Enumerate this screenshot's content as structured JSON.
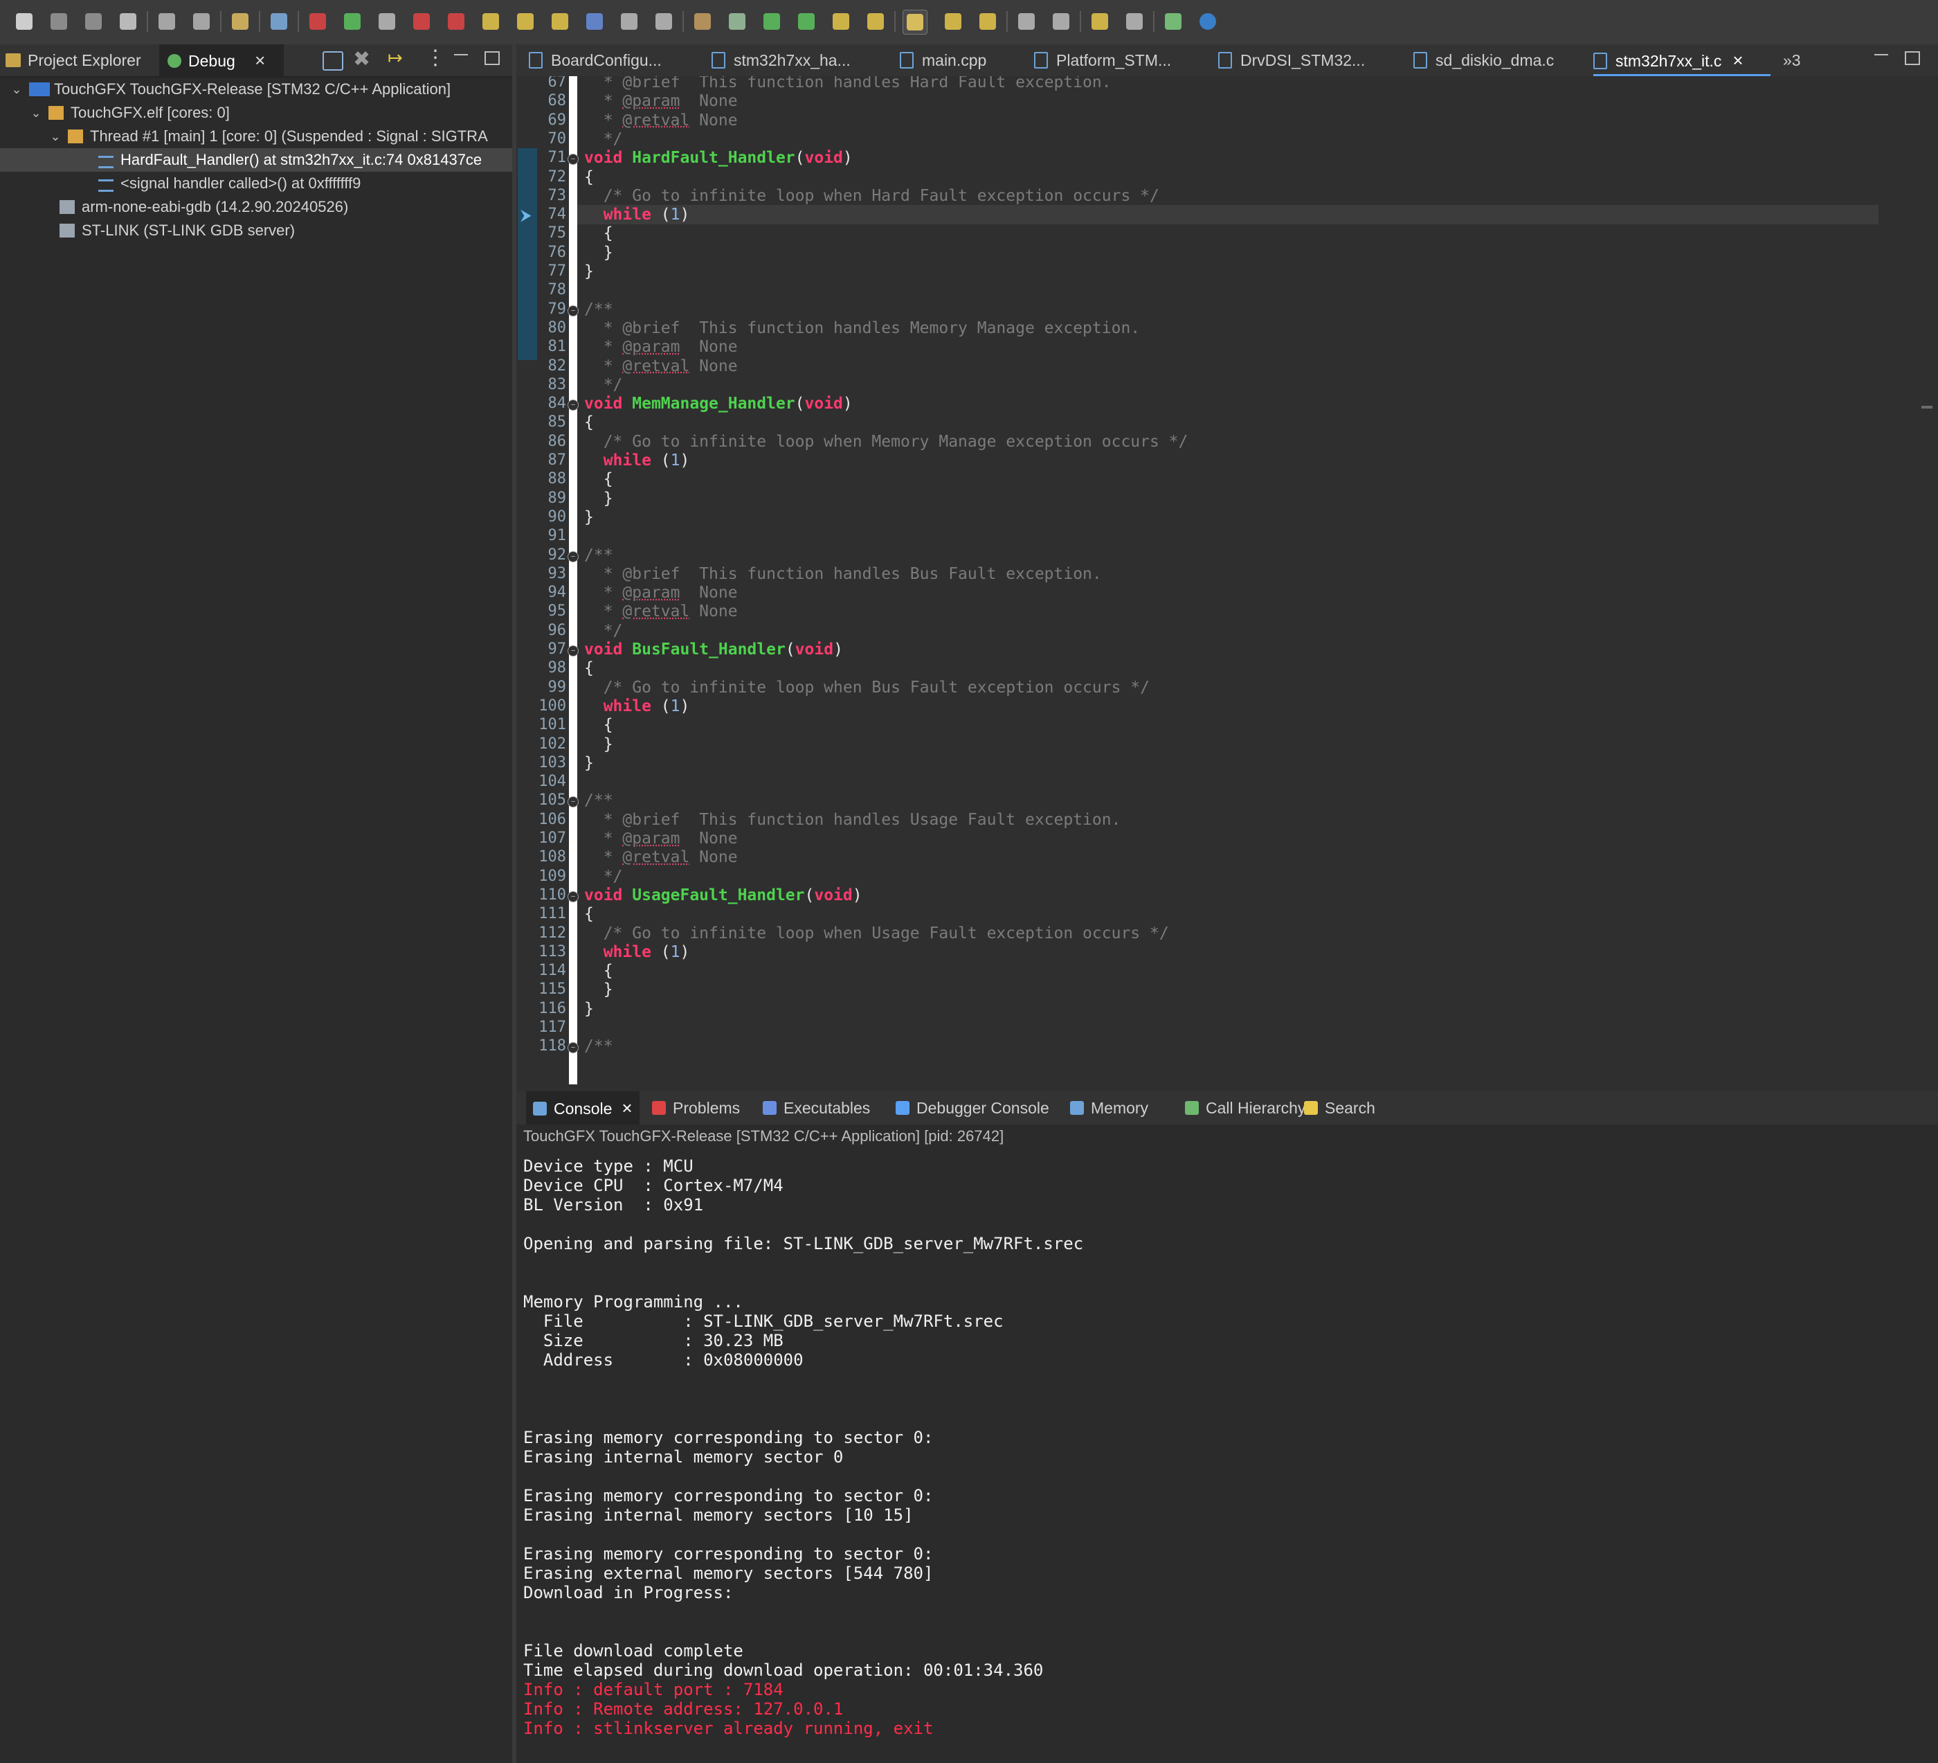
{
  "toolbar": {
    "buttons": [
      "new-icon",
      "save-icon",
      "save-all-icon",
      "build-icon",
      "undo-icon",
      "redo-icon",
      "refresh-icon",
      "search-icon",
      "debug-stop-icon",
      "resume-icon",
      "suspend-icon",
      "terminate-icon",
      "disconnect-icon",
      "step-into-icon",
      "step-over-icon",
      "step-return-icon",
      "instruction-step-icon",
      "drop-frame-icon",
      "use-step-filters-icon",
      "settings-icon",
      "target-icon",
      "run-icon",
      "debug-icon",
      "open-folder-icon",
      "pen-icon",
      "highlight-icon",
      "next-annotation-icon",
      "prev-annotation-icon",
      "back-icon",
      "forward-icon",
      "nav-back-icon",
      "nav-forward-icon",
      "open-perspective-icon",
      "info-icon"
    ]
  },
  "left_panel": {
    "tabs": [
      {
        "label": "Project Explorer",
        "active": false
      },
      {
        "label": "Debug",
        "active": true
      }
    ],
    "tree": [
      {
        "indent": 0,
        "twist": "v",
        "icon": "ide",
        "label": "TouchGFX TouchGFX-Release [STM32 C/C++ Application]"
      },
      {
        "indent": 1,
        "twist": "v",
        "icon": "elf",
        "label": "TouchGFX.elf [cores: 0]"
      },
      {
        "indent": 2,
        "twist": "v",
        "icon": "thread",
        "label": "Thread #1 [main] 1 [core: 0] (Suspended : Signal : SIGTRA"
      },
      {
        "indent": 3,
        "twist": "",
        "icon": "frame",
        "label": "HardFault_Handler() at stm32h7xx_it.c:74 0x81437ce",
        "selected": true
      },
      {
        "indent": 3,
        "twist": "",
        "icon": "frame",
        "label": "<signal handler called>() at 0xfffffff9"
      },
      {
        "indent": 1,
        "twist": "",
        "icon": "gdb",
        "label": "arm-none-eabi-gdb (14.2.90.20240526)"
      },
      {
        "indent": 1,
        "twist": "",
        "icon": "gdb",
        "label": "ST-LINK (ST-LINK GDB server)"
      }
    ]
  },
  "editor": {
    "tabs": [
      {
        "label": "BoardConfigu...",
        "active": false
      },
      {
        "label": "stm32h7xx_ha...",
        "active": false
      },
      {
        "label": "main.cpp",
        "active": false
      },
      {
        "label": "Platform_STM...",
        "active": false
      },
      {
        "label": "DrvDSI_STM32...",
        "active": false
      },
      {
        "label": "sd_diskio_dma.c",
        "active": false
      },
      {
        "label": "stm32h7xx_it.c",
        "active": true
      }
    ],
    "overflow_label": "»3",
    "lines": [
      {
        "n": "67",
        "t": "c",
        "text": "  * @brief  This function handles Hard Fault exception."
      },
      {
        "n": "68",
        "t": "p",
        "text": "  * @param  None"
      },
      {
        "n": "69",
        "t": "r",
        "text": "  * @retval None"
      },
      {
        "n": "70",
        "t": "c",
        "text": "  */"
      },
      {
        "n": "71",
        "t": "fn",
        "fold": true,
        "name": "HardFault_Handler"
      },
      {
        "n": "72",
        "t": "plain",
        "text": "{"
      },
      {
        "n": "73",
        "t": "c",
        "text": "  /* Go to infinite loop when Hard Fault exception occurs */"
      },
      {
        "n": "74",
        "t": "w",
        "current": true
      },
      {
        "n": "75",
        "t": "plain",
        "text": "  {"
      },
      {
        "n": "76",
        "t": "plain",
        "text": "  }"
      },
      {
        "n": "77",
        "t": "plain",
        "text": "}"
      },
      {
        "n": "78",
        "t": "plain",
        "text": ""
      },
      {
        "n": "79",
        "t": "c",
        "fold": true,
        "text": "/**"
      },
      {
        "n": "80",
        "t": "c",
        "text": "  * @brief  This function handles Memory Manage exception."
      },
      {
        "n": "81",
        "t": "p",
        "text": "  * @param  None"
      },
      {
        "n": "82",
        "t": "r",
        "text": "  * @retval None"
      },
      {
        "n": "83",
        "t": "c",
        "text": "  */"
      },
      {
        "n": "84",
        "t": "fn",
        "fold": true,
        "name": "MemManage_Handler"
      },
      {
        "n": "85",
        "t": "plain",
        "text": "{"
      },
      {
        "n": "86",
        "t": "c",
        "text": "  /* Go to infinite loop when Memory Manage exception occurs */"
      },
      {
        "n": "87",
        "t": "w"
      },
      {
        "n": "88",
        "t": "plain",
        "text": "  {"
      },
      {
        "n": "89",
        "t": "plain",
        "text": "  }"
      },
      {
        "n": "90",
        "t": "plain",
        "text": "}"
      },
      {
        "n": "91",
        "t": "plain",
        "text": ""
      },
      {
        "n": "92",
        "t": "c",
        "fold": true,
        "text": "/**"
      },
      {
        "n": "93",
        "t": "c",
        "text": "  * @brief  This function handles Bus Fault exception."
      },
      {
        "n": "94",
        "t": "p",
        "text": "  * @param  None"
      },
      {
        "n": "95",
        "t": "r",
        "text": "  * @retval None"
      },
      {
        "n": "96",
        "t": "c",
        "text": "  */"
      },
      {
        "n": "97",
        "t": "fn",
        "fold": true,
        "name": "BusFault_Handler"
      },
      {
        "n": "98",
        "t": "plain",
        "text": "{"
      },
      {
        "n": "99",
        "t": "c",
        "text": "  /* Go to infinite loop when Bus Fault exception occurs */"
      },
      {
        "n": "100",
        "t": "w"
      },
      {
        "n": "101",
        "t": "plain",
        "text": "  {"
      },
      {
        "n": "102",
        "t": "plain",
        "text": "  }"
      },
      {
        "n": "103",
        "t": "plain",
        "text": "}"
      },
      {
        "n": "104",
        "t": "plain",
        "text": ""
      },
      {
        "n": "105",
        "t": "c",
        "fold": true,
        "text": "/**"
      },
      {
        "n": "106",
        "t": "c",
        "text": "  * @brief  This function handles Usage Fault exception."
      },
      {
        "n": "107",
        "t": "p",
        "text": "  * @param  None"
      },
      {
        "n": "108",
        "t": "r",
        "text": "  * @retval None"
      },
      {
        "n": "109",
        "t": "c",
        "text": "  */"
      },
      {
        "n": "110",
        "t": "fn",
        "fold": true,
        "name": "UsageFault_Handler"
      },
      {
        "n": "111",
        "t": "plain",
        "text": "{"
      },
      {
        "n": "112",
        "t": "c",
        "text": "  /* Go to infinite loop when Usage Fault exception occurs */"
      },
      {
        "n": "113",
        "t": "w"
      },
      {
        "n": "114",
        "t": "plain",
        "text": "  {"
      },
      {
        "n": "115",
        "t": "plain",
        "text": "  }"
      },
      {
        "n": "116",
        "t": "plain",
        "text": "}"
      },
      {
        "n": "117",
        "t": "plain",
        "text": ""
      },
      {
        "n": "118",
        "t": "c",
        "fold": true,
        "text": "/**"
      }
    ]
  },
  "bottom_panel": {
    "tabs": [
      {
        "label": "Console",
        "icon": "console-icon",
        "active": true
      },
      {
        "label": "Problems",
        "icon": "problems-icon",
        "active": false
      },
      {
        "label": "Executables",
        "icon": "executables-icon",
        "active": false
      },
      {
        "label": "Debugger Console",
        "icon": "debugger-console-icon",
        "active": false
      },
      {
        "label": "Memory",
        "icon": "memory-icon",
        "active": false
      },
      {
        "label": "Call Hierarchy",
        "icon": "call-hierarchy-icon",
        "active": false
      },
      {
        "label": "Search",
        "icon": "search-icon",
        "active": false
      }
    ],
    "console_header": "TouchGFX TouchGFX-Release [STM32 C/C++ Application]  [pid: 26742]",
    "console_lines": [
      {
        "text": "Device type : MCU"
      },
      {
        "text": "Device CPU  : Cortex-M7/M4"
      },
      {
        "text": "BL Version  : 0x91"
      },
      {
        "text": ""
      },
      {
        "text": "Opening and parsing file: ST-LINK_GDB_server_Mw7RFt.srec"
      },
      {
        "text": ""
      },
      {
        "text": ""
      },
      {
        "text": "Memory Programming ..."
      },
      {
        "text": "  File          : ST-LINK_GDB_server_Mw7RFt.srec"
      },
      {
        "text": "  Size          : 30.23 MB"
      },
      {
        "text": "  Address       : 0x08000000"
      },
      {
        "text": ""
      },
      {
        "text": ""
      },
      {
        "text": ""
      },
      {
        "text": "Erasing memory corresponding to sector 0:"
      },
      {
        "text": "Erasing internal memory sector 0"
      },
      {
        "text": ""
      },
      {
        "text": "Erasing memory corresponding to sector 0:"
      },
      {
        "text": "Erasing internal memory sectors [10 15]"
      },
      {
        "text": ""
      },
      {
        "text": "Erasing memory corresponding to sector 0:"
      },
      {
        "text": "Erasing external memory sectors [544 780]"
      },
      {
        "text": "Download in Progress:"
      },
      {
        "text": ""
      },
      {
        "text": ""
      },
      {
        "text": "File download complete"
      },
      {
        "text": "Time elapsed during download operation: 00:01:34.360"
      },
      {
        "text": "Info : default port : 7184",
        "error": true
      },
      {
        "text": "Info : Remote address: 127.0.0.1",
        "error": true
      },
      {
        "text": "Info : stlinkserver already running, exit",
        "error": true
      }
    ]
  },
  "colors": {
    "keyword": "#ff3a6e",
    "function": "#4ed34e",
    "comment": "#7b7b7b",
    "error_text": "#ff2d4a",
    "active_tab_underline": "#5aa0f2"
  }
}
